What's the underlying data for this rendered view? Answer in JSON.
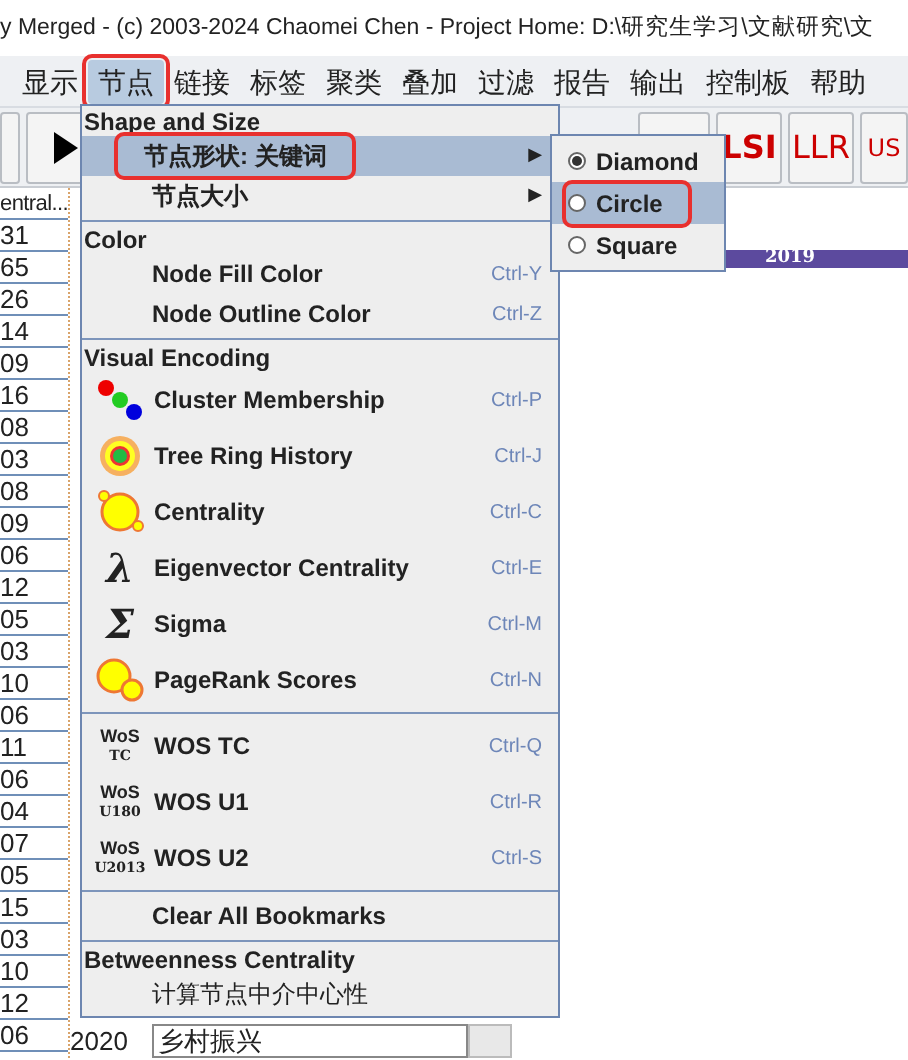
{
  "window": {
    "title": "y Merged - (c) 2003-2024 Chaomei Chen - Project Home: D:\\研究生学习\\文献研究\\文"
  },
  "menubar": [
    {
      "label": "显示",
      "selected": false,
      "annotated": false
    },
    {
      "label": "节点",
      "selected": true,
      "annotated": true
    },
    {
      "label": "链接",
      "selected": false,
      "annotated": false
    },
    {
      "label": "标签",
      "selected": false,
      "annotated": false
    },
    {
      "label": "聚类",
      "selected": false,
      "annotated": false
    },
    {
      "label": "叠加",
      "selected": false,
      "annotated": false
    },
    {
      "label": "过滤",
      "selected": false,
      "annotated": false
    },
    {
      "label": "报告",
      "selected": false,
      "annotated": false
    },
    {
      "label": "输出",
      "selected": false,
      "annotated": false
    },
    {
      "label": "控制板",
      "selected": false,
      "annotated": false
    },
    {
      "label": "帮助",
      "selected": false,
      "annotated": false
    }
  ],
  "toolbar": {
    "buttons": [
      "LSI",
      "LLR",
      "US"
    ]
  },
  "table": {
    "header": "entral...",
    "rows": [
      "31",
      "65",
      "26",
      "14",
      "09",
      "16",
      "08",
      "03",
      "08",
      "09",
      "06",
      "12",
      "05",
      "03",
      "10",
      "06",
      "11",
      "06",
      "04",
      "07",
      "05",
      "15",
      "03",
      "10",
      "12",
      "06"
    ]
  },
  "timeline": {
    "year": "2019"
  },
  "bottom_row": {
    "year": "2020",
    "term": "乡村振兴"
  },
  "menu": [
    {
      "kind": "section",
      "label": "Shape and Size"
    },
    {
      "kind": "item",
      "label": "节点形状: 关键词",
      "arrow": "▶",
      "selected": true,
      "annotated": true
    },
    {
      "kind": "item",
      "label": "节点大小",
      "arrow": "▶",
      "selected": false,
      "annotated": false
    },
    {
      "kind": "separator"
    },
    {
      "kind": "section",
      "label": "Color"
    },
    {
      "kind": "item",
      "label": "Node Fill Color",
      "shortcut": "Ctrl-Y",
      "selected": false
    },
    {
      "kind": "item",
      "label": "Node Outline Color",
      "shortcut": "Ctrl-Z",
      "selected": false
    },
    {
      "kind": "separator"
    },
    {
      "kind": "section",
      "label": "Visual Encoding"
    },
    {
      "kind": "cluster",
      "label": "Cluster Membership",
      "shortcut": "Ctrl-P",
      "selected": false
    },
    {
      "kind": "ring",
      "label": "Tree Ring History",
      "shortcut": "Ctrl-J",
      "selected": false
    },
    {
      "kind": "centrality",
      "label": "Centrality",
      "shortcut": "Ctrl-C",
      "selected": false
    },
    {
      "kind": "symbol",
      "glyph": "λ",
      "label": "Eigenvector Centrality",
      "shortcut": "Ctrl-E",
      "selected": false
    },
    {
      "kind": "symbol",
      "glyph": "Σ",
      "label": "Sigma",
      "shortcut": "Ctrl-M",
      "selected": false
    },
    {
      "kind": "pagerank",
      "label": "PageRank Scores",
      "shortcut": "Ctrl-N",
      "selected": false
    },
    {
      "kind": "separator"
    },
    {
      "kind": "wos",
      "wos": [
        "WoS",
        "TC"
      ],
      "label": "WOS TC",
      "shortcut": "Ctrl-Q",
      "selected": false
    },
    {
      "kind": "wos",
      "wos": [
        "WoS",
        "U180"
      ],
      "label": "WOS U1",
      "shortcut": "Ctrl-R",
      "selected": false
    },
    {
      "kind": "wos",
      "wos": [
        "WoS",
        "U2013"
      ],
      "label": "WOS U2",
      "shortcut": "Ctrl-S",
      "selected": false
    },
    {
      "kind": "separator"
    },
    {
      "kind": "item",
      "label": "Clear All Bookmarks",
      "selected": false
    },
    {
      "kind": "separator"
    },
    {
      "kind": "section",
      "label": "Betweenness Centrality"
    },
    {
      "kind": "item",
      "label": "计算节点中介中心性",
      "selected": false,
      "plain": true
    }
  ],
  "submenu": [
    {
      "label": "Diamond",
      "checked": true,
      "selected": false,
      "annotated": false
    },
    {
      "label": "Circle",
      "checked": false,
      "selected": true,
      "annotated": true
    },
    {
      "label": "Square",
      "checked": false,
      "selected": false,
      "annotated": false
    }
  ]
}
